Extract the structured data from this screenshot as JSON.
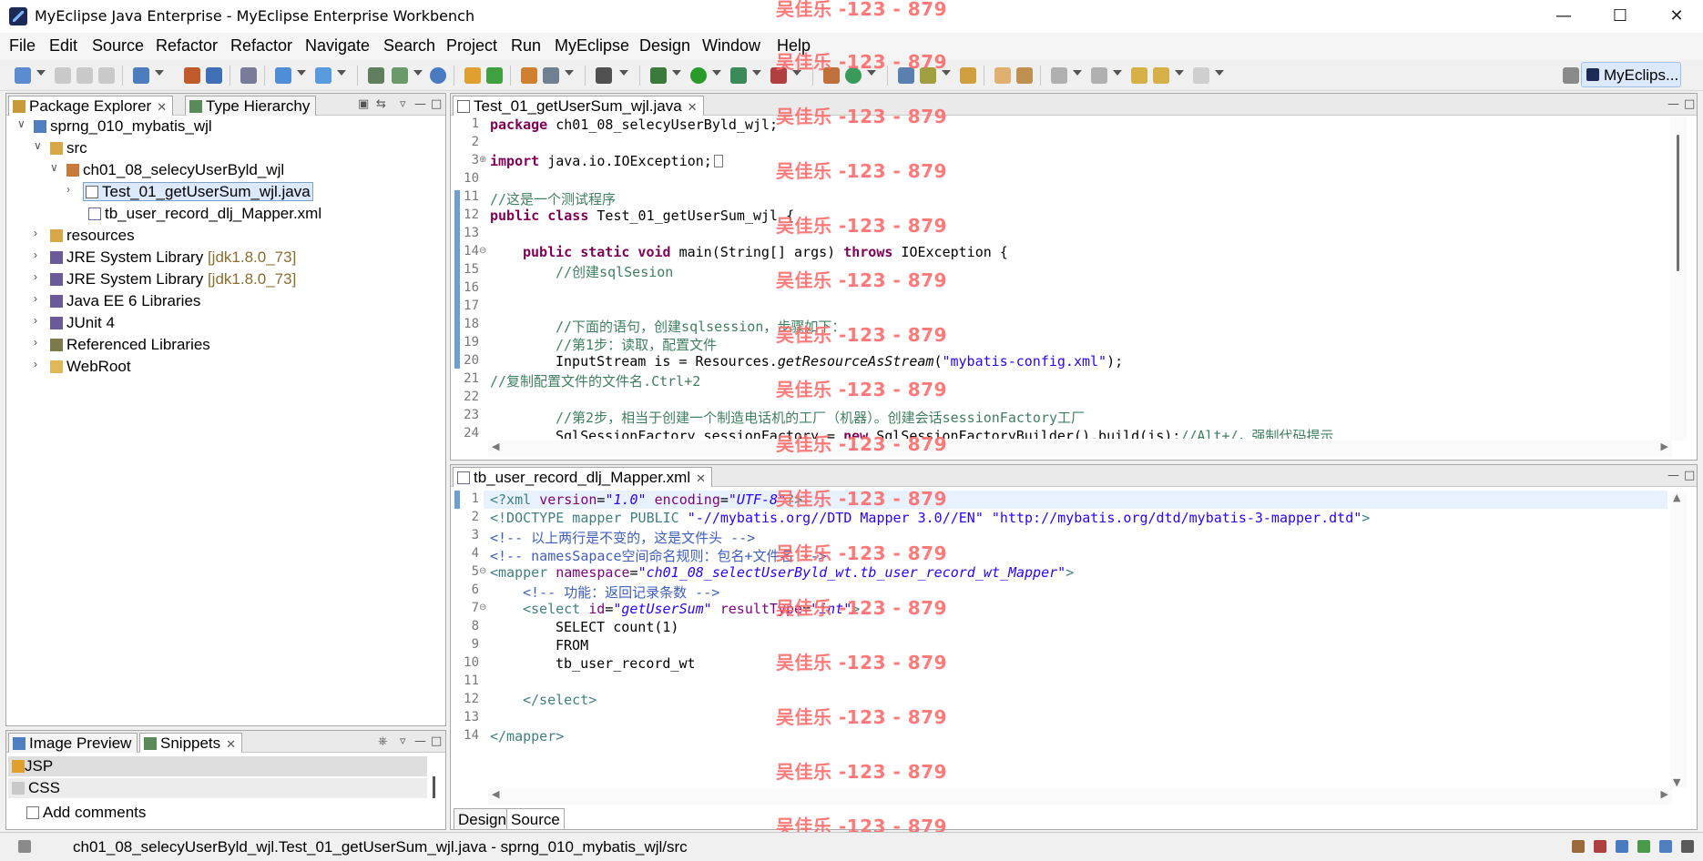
{
  "window": {
    "title": "MyEclipse Java Enterprise - MyEclipse Enterprise Workbench",
    "minimize_icon": "minimize-icon",
    "maximize_icon": "maximize-icon",
    "close_icon": "close-icon"
  },
  "menu": [
    "File",
    "Edit",
    "Source",
    "Refactor",
    "Refactor",
    "Navigate",
    "Search",
    "Project",
    "Run",
    "MyEclipse",
    "Design",
    "Window",
    "Help"
  ],
  "perspective": {
    "label": "MyEclips..."
  },
  "package_explorer": {
    "tab_label": "Package Explorer",
    "tab2_label": "Type Hierarchy",
    "tree": {
      "project": "sprng_010_mybatis_wjl",
      "src": "src",
      "package": "ch01_08_selecyUserByld_wjl",
      "file1": "Test_01_getUserSum_wjl.java",
      "file2": "tb_user_record_dlj_Mapper.xml",
      "resources": "resources",
      "jre1": "JRE System Library",
      "jre1_dec": "[jdk1.8.0_73]",
      "jre2": "JRE System Library",
      "jre2_dec": "[jdk1.8.0_73]",
      "javaee": "Java EE 6 Libraries",
      "junit": "JUnit 4",
      "reflibs": "Referenced Libraries",
      "webroot": "WebRoot"
    }
  },
  "snippets": {
    "tab1_label": "Image Preview",
    "tab2_label": "Snippets",
    "items": [
      "JSP",
      "CSS",
      "Add comments"
    ]
  },
  "java_editor": {
    "tab_label": "Test_01_getUserSum_wjl.java",
    "line_numbers": [
      "1",
      "2",
      "3",
      "10",
      "11",
      "12",
      "13",
      "14",
      "15",
      "16",
      "17",
      "18",
      "19",
      "20",
      "21",
      "22",
      "23",
      "24"
    ],
    "lines": {
      "l1_kw": "package",
      "l1_rest": " ch01_08_selecyUserByld_wjl;",
      "l3_kw": "import",
      "l3_rest": " java.io.IOException;",
      "l11": "//这是一个测试程序",
      "l12_kw": "public class",
      "l12_rest": " Test_01_getUserSum_wjl {",
      "l14_kw1": "public static void",
      "l14_mid": " main(String[] args) ",
      "l14_kw2": "throws",
      "l14_rest": " IOException {",
      "l15": "//创建sqlSesion",
      "l18": "//下面的语句，创建sqlsession，步骤如下：",
      "l19": "//第1步：读取，配置文件",
      "l20_a": "InputStream is = Resources.",
      "l20_it": "getResourceAsStream",
      "l20_b": "(",
      "l20_str": "\"mybatis-config.xml\"",
      "l20_c": ");",
      "l21": "//复制配置文件的文件名.Ctrl+2",
      "l23": "//第2步，相当于创建一个制造电话机的工厂（机器）。创建会话sessionFactory工厂",
      "l24_a": "SqlSessionFactory sessionFactory = ",
      "l24_kw": "new",
      "l24_b": " SqlSessionFactoryBuilder().build(is);",
      "l24_cm": "//Alt+/，强制代码提示"
    }
  },
  "xml_editor": {
    "tab_label": "tb_user_record_dlj_Mapper.xml",
    "line_numbers": [
      "1",
      "2",
      "3",
      "4",
      "5",
      "6",
      "7",
      "8",
      "9",
      "10",
      "11",
      "12",
      "13",
      "14"
    ],
    "lines": {
      "x1_a": "<?xml ",
      "x1_attr1": "version",
      "x1_eq1": "=",
      "x1_v1": "\"1.0\"",
      "x1_attr2": " encoding",
      "x1_eq2": "=",
      "x1_v2": "\"UTF-8\"",
      "x1_end": "?>",
      "x2_a": "<!DOCTYPE mapper PUBLIC ",
      "x2_s1": "\"-//mybatis.org//DTD Mapper 3.0//EN\"",
      "x2_s2": " \"http://mybatis.org/dtd/mybatis-3-mapper.dtd\"",
      "x2_end": ">",
      "x3": "<!-- 以上两行是不变的，这是文件头 -->",
      "x4": "<!-- namesSapace空间命名规则：包名+文件名 -->",
      "x5_a": "<mapper ",
      "x5_attr": "namespace",
      "x5_eq": "=",
      "x5_v": "\"ch01_08_selectUserByld_wt.tb_user_record_wt_Mapper\"",
      "x5_end": ">",
      "x6": "<!-- 功能：返回记录条数 -->",
      "x7_a": "<select ",
      "x7_attr1": "id",
      "x7_v1": "\"getUserSum\"",
      "x7_attr2": " resultType",
      "x7_v2": "\"int\"",
      "x7_end": ">",
      "x8": "SELECT count(1)",
      "x9": "FROM",
      "x10": "tb_user_record_wt",
      "x12": "</select>",
      "x14": "</mapper>"
    },
    "bottom_tabs": [
      "Design",
      "Source"
    ]
  },
  "watermark": "吴佳乐 -123 - 879",
  "status": {
    "text": "ch01_08_selecyUserByld_wjl.Test_01_getUserSum_wjl.java - sprng_010_mybatis_wjl/src"
  }
}
